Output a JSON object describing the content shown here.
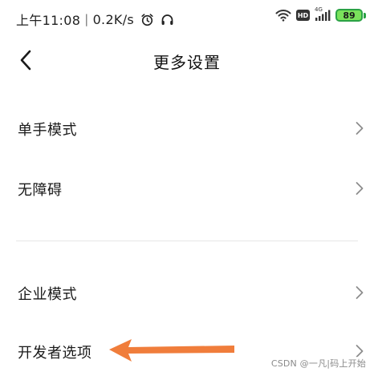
{
  "status_bar": {
    "time": "上午11:08",
    "speed": "0.2K/s",
    "hd_label": "HD",
    "network_label": "4G",
    "battery_level": "89",
    "icons": [
      "alarm-icon",
      "headset-icon",
      "wifi-icon",
      "hd-icon",
      "signal-icon",
      "battery-icon"
    ],
    "battery_color": "#7ae15b"
  },
  "header": {
    "title": "更多设置",
    "back_icon": "chevron-left-icon"
  },
  "list": {
    "items": [
      {
        "label": "单手模式",
        "icon": "chevron-right-icon"
      },
      {
        "label": "无障碍",
        "icon": "chevron-right-icon"
      },
      {
        "label": "企业模式",
        "icon": "chevron-right-icon"
      },
      {
        "label": "开发者选项",
        "icon": "chevron-right-icon"
      }
    ]
  },
  "annotation": {
    "arrow_color": "#f07d3b"
  },
  "watermark": {
    "text": "CSDN @一凡|码上开始"
  }
}
